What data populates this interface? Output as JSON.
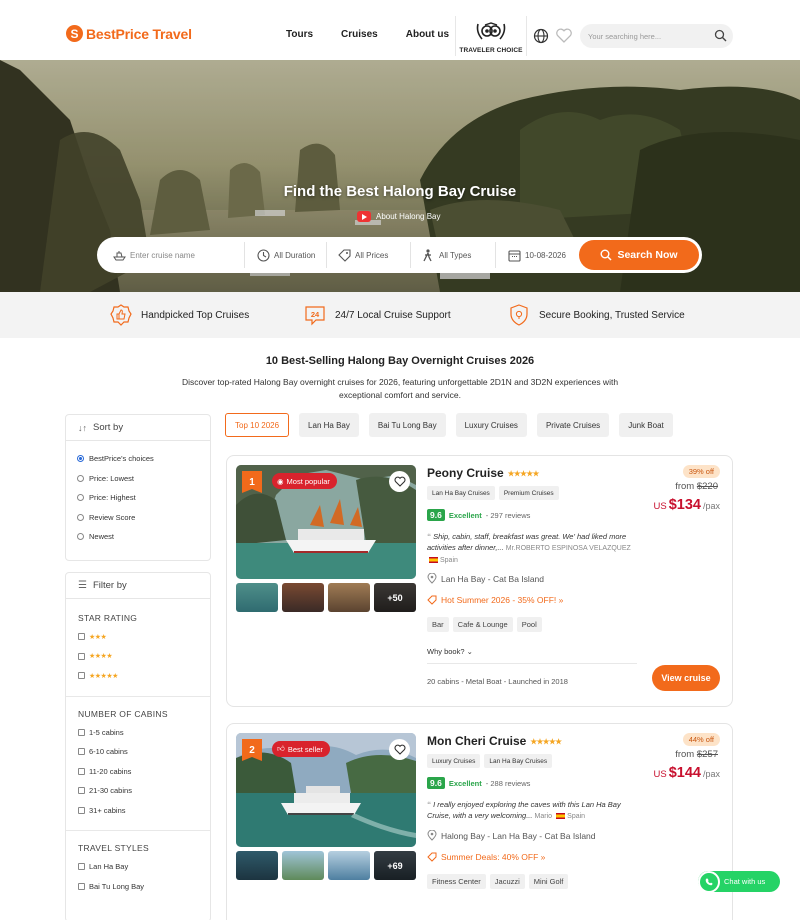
{
  "brand": {
    "name": "BestPrice Travel",
    "accent": "#f26a1b"
  },
  "nav": {
    "items": [
      "Tours",
      "Cruises",
      "About us"
    ],
    "traveler_choice": "TRAVELER CHOICE"
  },
  "search": {
    "placeholder": "Your searching here..."
  },
  "hero": {
    "title": "Find the Best Halong Bay Cruise",
    "video_link": "About Halong Bay",
    "filters": {
      "cruise_placeholder": "Enter cruise name",
      "duration": "All Duration",
      "prices": "All Prices",
      "types": "All Types",
      "date": "10-08-2026",
      "button": "Search Now"
    }
  },
  "features": [
    "Handpicked Top Cruises",
    "24/7 Local Cruise Support",
    "Secure Booking, Trusted Service"
  ],
  "section": {
    "title": "10 Best-Selling Halong Bay Overnight Cruises 2026",
    "description": "Discover top-rated Halong Bay overnight cruises for 2026, featuring unforgettable 2D1N and 3D2N experiences with exceptional comfort and service."
  },
  "sort": {
    "title": "Sort by",
    "options": [
      "BestPrice's choices",
      "Price: Lowest",
      "Price: Highest",
      "Review Score",
      "Newest"
    ],
    "selected": "BestPrice's choices"
  },
  "filter": {
    "title": "Filter by",
    "star_title": "STAR RATING",
    "stars": [
      "★★★",
      "★★★★",
      "★★★★★"
    ],
    "cabins_title": "NUMBER OF CABINS",
    "cabins": [
      "1-5 cabins",
      "6-10 cabins",
      "11-20 cabins",
      "21-30 cabins",
      "31+ cabins"
    ],
    "styles_title": "TRAVEL STYLES",
    "styles": [
      "Lan Ha Bay",
      "Bai Tu Long Bay"
    ]
  },
  "chips": [
    "Top 10 2026",
    "Lan Ha Bay",
    "Bai Tu Long Bay",
    "Luxury Cruises",
    "Private Cruises",
    "Junk Boat"
  ],
  "cruises": [
    {
      "rank": "1",
      "badge": "Most popular",
      "name": "Peony Cruise",
      "stars": "★★★★★",
      "tags": [
        "Lan Ha Bay Cruises",
        "Premium Cruises"
      ],
      "score": "9.6",
      "score_label": "Excellent",
      "reviews": "- 297 reviews",
      "quote": "Ship, cabin, staff, breakfast was great. We' had liked more activities after dinner,...",
      "author": "Mr.ROBERTO ESPINOSA VELAZQUEZ",
      "country": "Spain",
      "route": "Lan Ha Bay - Cat Ba Island",
      "deal": "Hot Summer 2026 - 35% OFF! »",
      "amenities": [
        "Bar",
        "Cafe & Lounge",
        "Pool"
      ],
      "why": "Why book?",
      "specs": "20 cabins - Metal Boat - Launched in 2018",
      "discount": "39% off",
      "from_label": "from",
      "old_price": "$220",
      "currency": "US",
      "price": "$134",
      "per": "/pax",
      "more_photos": "+50",
      "button": "View cruise"
    },
    {
      "rank": "2",
      "badge": "Best seller",
      "name": "Mon Cheri Cruise",
      "stars": "★★★★★",
      "tags": [
        "Luxury Cruises",
        "Lan Ha Bay Cruises"
      ],
      "score": "9.6",
      "score_label": "Excellent",
      "reviews": "- 288 reviews",
      "quote": "I really enjoyed exploring the caves with this Lan Ha Bay Cruise, with a very welcoming...",
      "author": "Mario",
      "country": "Spain",
      "route": "Halong Bay - Lan Ha Bay - Cat Ba Island",
      "deal": "Summer Deals: 40% OFF »",
      "amenities": [
        "Fitness Center",
        "Jacuzzi",
        "Mini Golf"
      ],
      "discount": "44% off",
      "from_label": "from",
      "old_price": "$257",
      "currency": "US",
      "price": "$144",
      "per": "/pax",
      "more_photos": "+69"
    }
  ],
  "chat": {
    "label": "Chat with us"
  }
}
